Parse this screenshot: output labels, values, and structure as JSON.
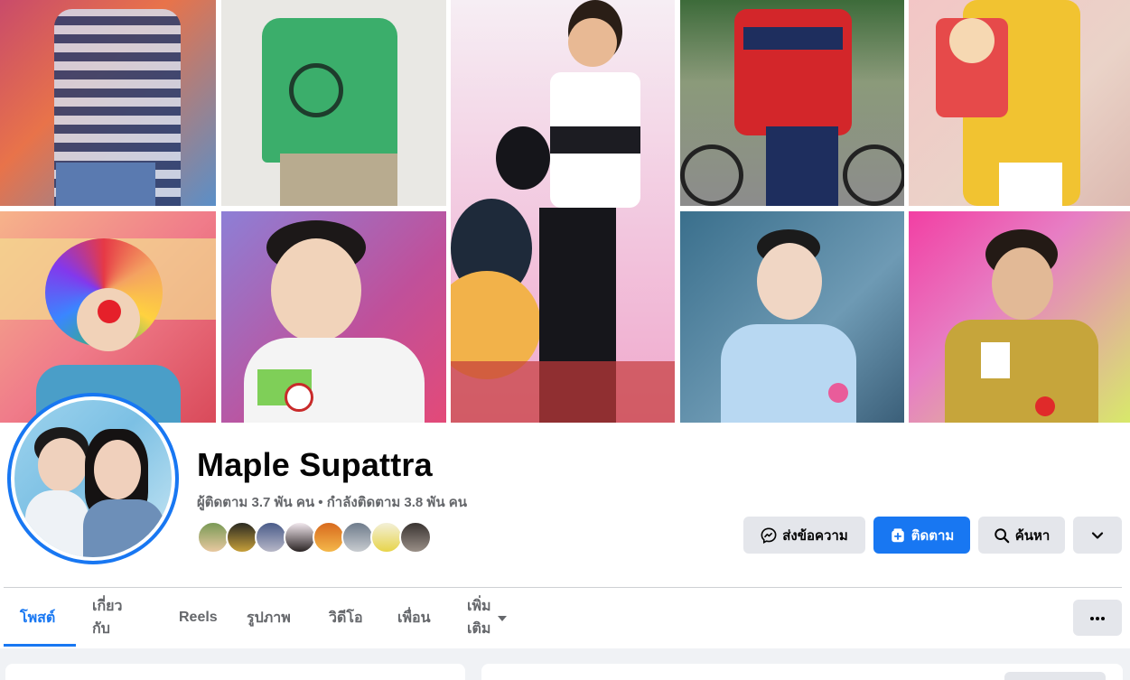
{
  "profile": {
    "name": "Maple Supattra",
    "stats": "ผู้ติดตาม 3.7 พัน คน • กำลังติดตาม 3.8 พัน คน"
  },
  "actions": {
    "message_label": "ส่งข้อความ",
    "message_icon": "messenger-icon",
    "follow_label": "ติดตาม",
    "follow_icon": "follow-plus-icon",
    "search_label": "ค้นหา",
    "search_icon": "search-icon",
    "expand_icon": "chevron-down-icon"
  },
  "tabs": [
    {
      "label": "โพสต์",
      "active": true
    },
    {
      "label": "เกี่ยวกับ",
      "active": false
    },
    {
      "label": "Reels",
      "active": false
    },
    {
      "label": "รูปภาพ",
      "active": false
    },
    {
      "label": "วิดีโอ",
      "active": false
    },
    {
      "label": "เพื่อน",
      "active": false
    },
    {
      "label": "เพิ่มเติม",
      "active": false
    }
  ],
  "more_menu_icon": "ellipsis-icon",
  "colors": {
    "accent": "#1877f2",
    "text_primary": "#050505",
    "text_secondary": "#65676b",
    "button_secondary": "#e4e6eb",
    "page_bg": "#f0f2f5"
  }
}
